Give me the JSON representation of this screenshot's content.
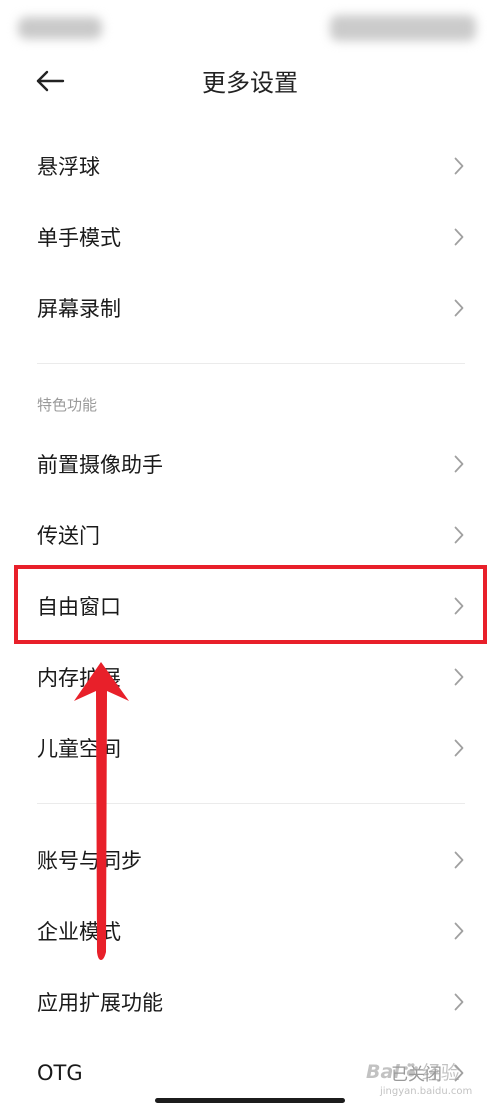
{
  "header": {
    "title": "更多设置",
    "back_icon": "arrow-left-icon"
  },
  "sections": [
    {
      "items": [
        {
          "label": "悬浮球"
        },
        {
          "label": "单手模式"
        },
        {
          "label": "屏幕录制"
        }
      ]
    },
    {
      "title": "特色功能",
      "items": [
        {
          "label": "前置摄像助手"
        },
        {
          "label": "传送门"
        },
        {
          "label": "自由窗口",
          "highlighted": true
        },
        {
          "label": "内存扩展"
        },
        {
          "label": "儿童空间"
        }
      ]
    },
    {
      "items": [
        {
          "label": "账号与同步"
        },
        {
          "label": "企业模式"
        },
        {
          "label": "应用扩展功能"
        },
        {
          "label": "OTG",
          "value": "已关闭"
        }
      ]
    }
  ],
  "row_icon": "chevron-right-icon",
  "annotation_icon": "arrow-up-icon",
  "colors": {
    "background": "#ffffff",
    "text": "#1a1a1a",
    "secondary_text": "#9a9a9a",
    "divider": "#ebebeb",
    "annotation_red": "#e8202a"
  },
  "watermark": {
    "brand": "Bai",
    "text": "经验",
    "url": "jingyan.baidu.com"
  }
}
